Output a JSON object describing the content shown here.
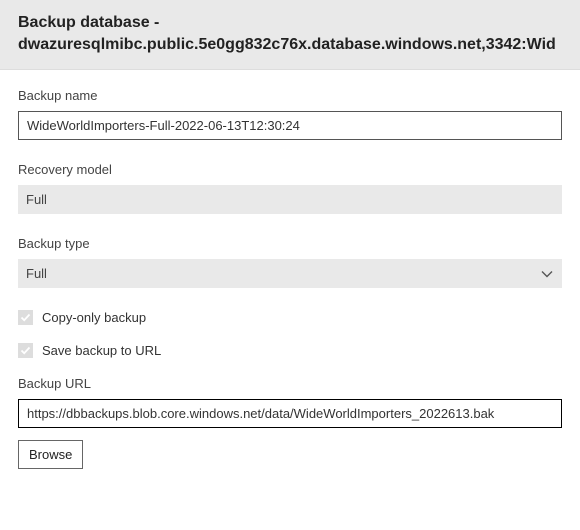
{
  "header": {
    "title_line1": "Backup database -",
    "title_line2": "dwazuresqlmibc.public.5e0gg832c76x.database.windows.net,3342:Wid"
  },
  "fields": {
    "backup_name": {
      "label": "Backup name",
      "value": "WideWorldImporters-Full-2022-06-13T12:30:24"
    },
    "recovery_model": {
      "label": "Recovery model",
      "value": "Full"
    },
    "backup_type": {
      "label": "Backup type",
      "value": "Full"
    },
    "copy_only": {
      "label": "Copy-only backup",
      "checked": true
    },
    "save_to_url": {
      "label": "Save backup to URL",
      "checked": true
    },
    "backup_url": {
      "label": "Backup URL",
      "value": "https://dbbackups.blob.core.windows.net/data/WideWorldImporters_2022613.bak"
    },
    "browse_label": "Browse"
  }
}
